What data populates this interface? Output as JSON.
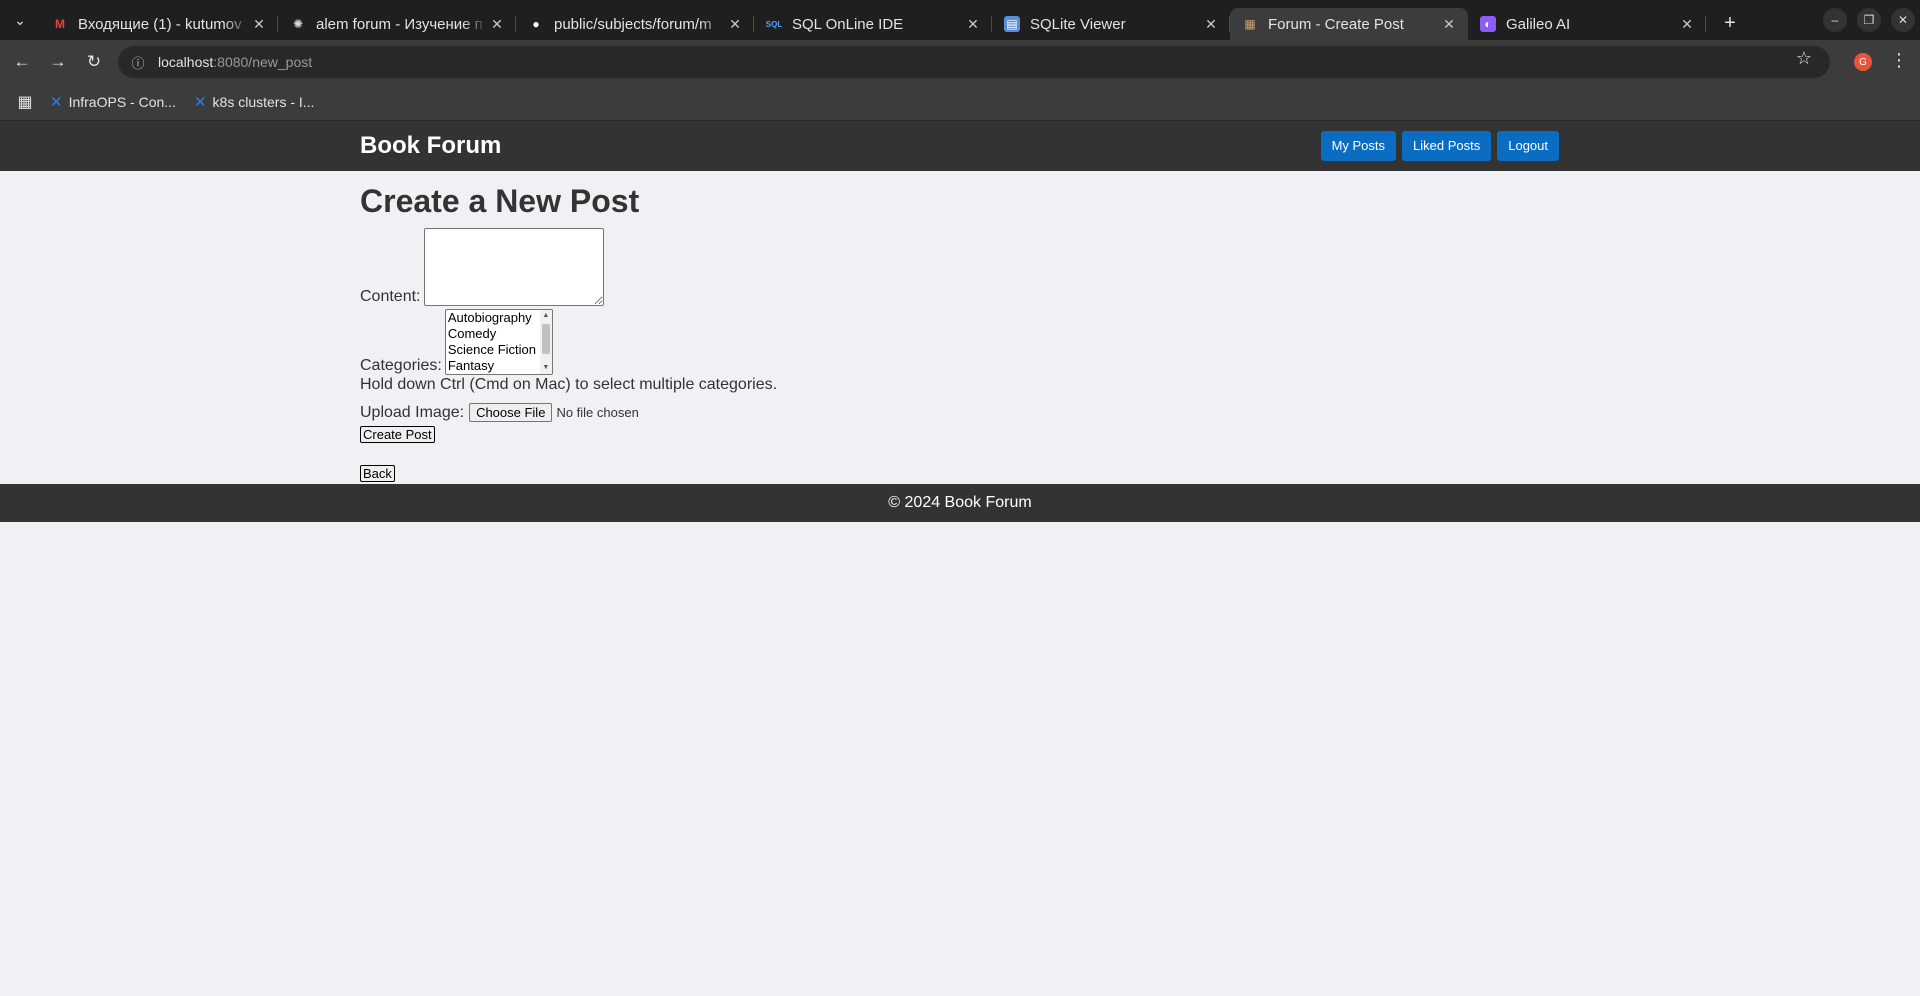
{
  "browser": {
    "tabs": [
      {
        "title": "Входящие (1) - kutumov",
        "favicon": "gmail-icon",
        "active": false
      },
      {
        "title": "alem forum - Изучение п",
        "favicon": "openai-icon",
        "active": false
      },
      {
        "title": "public/subjects/forum/m",
        "favicon": "github-icon",
        "active": false
      },
      {
        "title": "SQL OnLine IDE",
        "favicon": "sql-icon",
        "active": false
      },
      {
        "title": "SQLite Viewer",
        "favicon": "sqlite-icon",
        "active": false
      },
      {
        "title": "Forum - Create Post",
        "favicon": "forum-icon",
        "active": true
      },
      {
        "title": "Galileo AI",
        "favicon": "galileo-icon",
        "active": false
      }
    ],
    "url_host": "localhost",
    "url_path": ":8080/new_post",
    "profile_initial": "G",
    "bookmarks": [
      {
        "label": "InfraOPS - Con..."
      },
      {
        "label": "k8s clusters - I..."
      }
    ]
  },
  "header": {
    "logo": "Book Forum",
    "nav": [
      "My Posts",
      "Liked Posts",
      "Logout"
    ]
  },
  "form": {
    "heading": "Create a New Post",
    "content_label": "Content:",
    "content_value": "",
    "categories_label": "Categories:",
    "categories": [
      "Autobiography",
      "Comedy",
      "Science Fiction",
      "Fantasy"
    ],
    "hint": "Hold down Ctrl (Cmd on Mac) to select multiple categories.",
    "upload_label": "Upload Image:",
    "choose_file": "Choose File",
    "no_file": "No file chosen",
    "submit": "Create Post",
    "back": "Back"
  },
  "footer": {
    "text": "© 2024 Book Forum"
  },
  "colors": {
    "header_bg": "#333333",
    "nav_button": "#0a6dc2",
    "page_bg": "#f0f1f4"
  }
}
